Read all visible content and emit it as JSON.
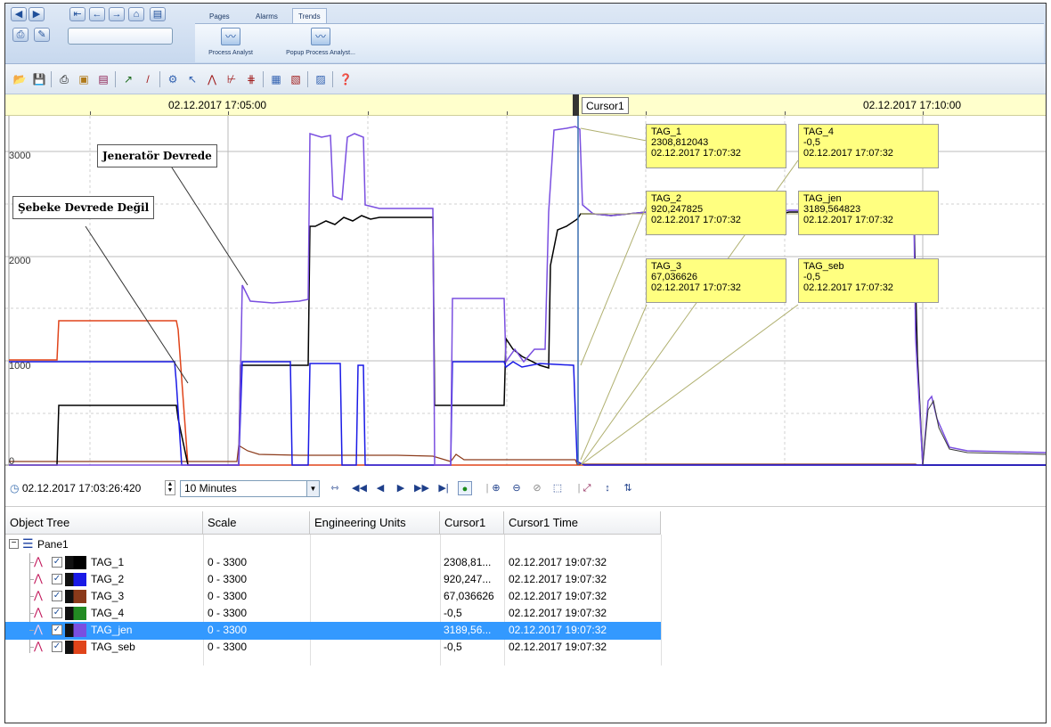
{
  "ribbon": {
    "tabs": [
      {
        "label": "Pages",
        "active": false
      },
      {
        "label": "Alarms",
        "active": false
      },
      {
        "label": "Trends",
        "active": true
      }
    ],
    "buttons": [
      {
        "label": "Process Analyst",
        "icon": "process-analyst-icon"
      },
      {
        "label": "Popup Process Analyst...",
        "icon": "popup-process-analyst-icon"
      }
    ]
  },
  "time_header": {
    "left_label": "02.12.2017 17:05:00",
    "right_label": "02.12.2017 17:10:00",
    "cursor_label": "Cursor1"
  },
  "plot": {
    "y_labels": [
      "3000",
      "2000",
      "1000",
      "0"
    ],
    "annotations": {
      "jenerator": "Jeneratör Devrede",
      "sebeke": "Şebeke Devrede Değil"
    },
    "cursor_boxes": [
      {
        "tag": "TAG_1",
        "value": "2308,812043",
        "time": "02.12.2017 17:07:32"
      },
      {
        "tag": "TAG_4",
        "value": "-0,5",
        "time": "02.12.2017 17:07:32"
      },
      {
        "tag": "TAG_2",
        "value": "920,247825",
        "time": "02.12.2017 17:07:32"
      },
      {
        "tag": "TAG_jen",
        "value": "3189,564823",
        "time": "02.12.2017 17:07:32"
      },
      {
        "tag": "TAG_3",
        "value": "67,036626",
        "time": "02.12.2017 17:07:32"
      },
      {
        "tag": "TAG_seb",
        "value": "-0,5",
        "time": "02.12.2017 17:07:32"
      }
    ],
    "colors": {
      "TAG_1": "#000000",
      "TAG_2": "#1a1ae6",
      "TAG_3": "#8b3a1a",
      "TAG_4": "#228b22",
      "TAG_jen": "#7a4fe0",
      "TAG_seb": "#e0441a"
    }
  },
  "navbar": {
    "start_time": "02.12.2017 17:03:26:420",
    "span": "10 Minutes"
  },
  "grid": {
    "headers": [
      "Object Tree",
      "Scale",
      "Engineering Units",
      "Cursor1",
      "Cursor1 Time"
    ],
    "pane": "Pane1",
    "rows": [
      {
        "tag": "TAG_1",
        "color": "#000000",
        "scale": "0 - 3300",
        "units": "",
        "cursor": "2308,81...",
        "time": "02.12.2017 19:07:32",
        "selected": false
      },
      {
        "tag": "TAG_2",
        "color": "#1a1ae6",
        "scale": "0 - 3300",
        "units": "",
        "cursor": "920,247...",
        "time": "02.12.2017 19:07:32",
        "selected": false
      },
      {
        "tag": "TAG_3",
        "color": "#8b3a1a",
        "scale": "0 - 3300",
        "units": "",
        "cursor": "67,036626",
        "time": "02.12.2017 19:07:32",
        "selected": false
      },
      {
        "tag": "TAG_4",
        "color": "#228b22",
        "scale": "0 - 3300",
        "units": "",
        "cursor": "-0,5",
        "time": "02.12.2017 19:07:32",
        "selected": false
      },
      {
        "tag": "TAG_jen",
        "color": "#7a4fe0",
        "scale": "0 - 3300",
        "units": "",
        "cursor": "3189,56...",
        "time": "02.12.2017 19:07:32",
        "selected": true
      },
      {
        "tag": "TAG_seb",
        "color": "#e0441a",
        "scale": "0 - 3300",
        "units": "",
        "cursor": "-0,5",
        "time": "02.12.2017 19:07:32",
        "selected": false
      }
    ]
  }
}
